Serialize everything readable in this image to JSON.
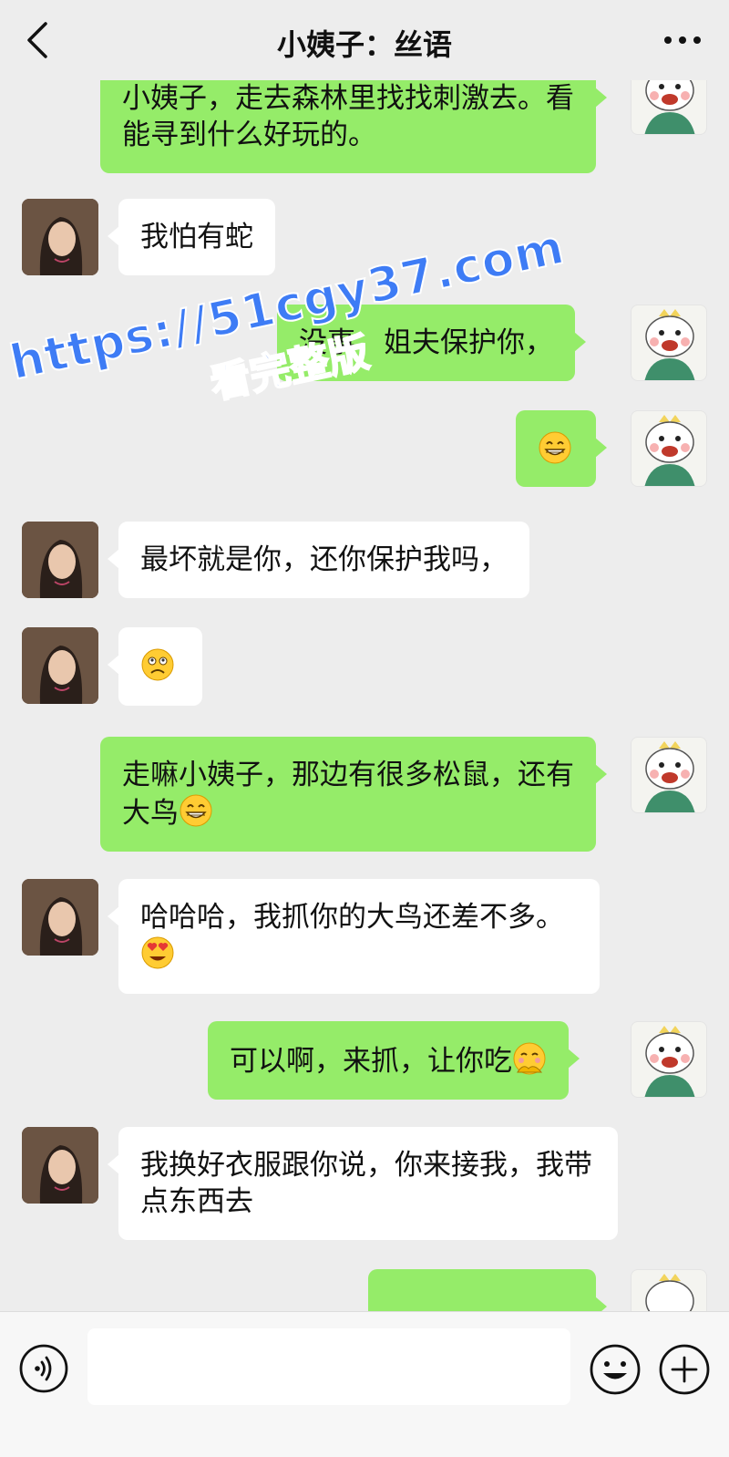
{
  "header": {
    "title": "小姨子：丝语",
    "back_icon": "chevron-left-icon",
    "more_icon": "more-dots-icon"
  },
  "messages": [
    {
      "sender": "me",
      "text": "小姨子，走去森林里找找刺激去。看能寻到什么好玩的。"
    },
    {
      "sender": "her",
      "text": "我怕有蛇"
    },
    {
      "sender": "me",
      "text": "没事，姐夫保护你，"
    },
    {
      "sender": "me",
      "emoji": "grin-emoji"
    },
    {
      "sender": "her",
      "text": "最坏就是你，还你保护我吗，"
    },
    {
      "sender": "her",
      "emoji": "awkward-emoji"
    },
    {
      "sender": "me",
      "text": "走嘛小姨子，那边有很多松鼠，还有大鸟",
      "emoji": "grin-emoji"
    },
    {
      "sender": "her",
      "text": "哈哈哈，我抓你的大鸟还差不多。",
      "emoji": "heart-eyes-emoji"
    },
    {
      "sender": "me",
      "text": "可以啊，来抓，让你吃",
      "emoji": "shy-emoji"
    },
    {
      "sender": "her",
      "text": "我换好衣服跟你说，你来接我，我带点东西去"
    }
  ],
  "watermark": {
    "url": "https://51cgy37.com",
    "sub": "看完整版"
  },
  "input_bar": {
    "value": "",
    "voice_icon": "voice-icon",
    "emoji_icon": "emoji-icon",
    "plus_icon": "plus-icon"
  },
  "colors": {
    "background": "#ededed",
    "my_bubble": "#95ec69",
    "her_bubble": "#ffffff",
    "watermark": "#3e7cf5"
  }
}
